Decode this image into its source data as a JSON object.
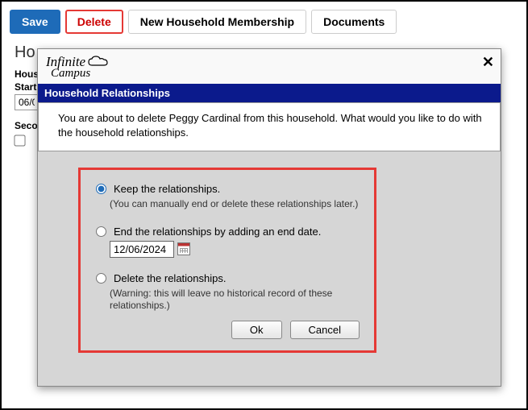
{
  "toolbar": {
    "save_label": "Save",
    "delete_label": "Delete",
    "new_membership_label": "New Household Membership",
    "documents_label": "Documents"
  },
  "page": {
    "heading_prefix": "Ho",
    "form_hous_label": "Hous",
    "form_start_label": "Start",
    "form_start_value": "06/0",
    "form_seco_label": "Seco"
  },
  "dialog": {
    "brand": "Infinite Campus",
    "title": "Household Relationships",
    "message": "You are about to delete Peggy Cardinal from this household. What would you like to do with the household relationships.",
    "options": {
      "keep": {
        "label": "Keep the relationships.",
        "sub": "(You can manually end or delete these relationships later.)"
      },
      "end": {
        "label": "End the relationships by adding an end date.",
        "date": "12/06/2024"
      },
      "delete": {
        "label": "Delete the relationships.",
        "sub": "(Warning: this will leave no historical record of these relationships.)"
      }
    },
    "buttons": {
      "ok": "Ok",
      "cancel": "Cancel"
    }
  }
}
